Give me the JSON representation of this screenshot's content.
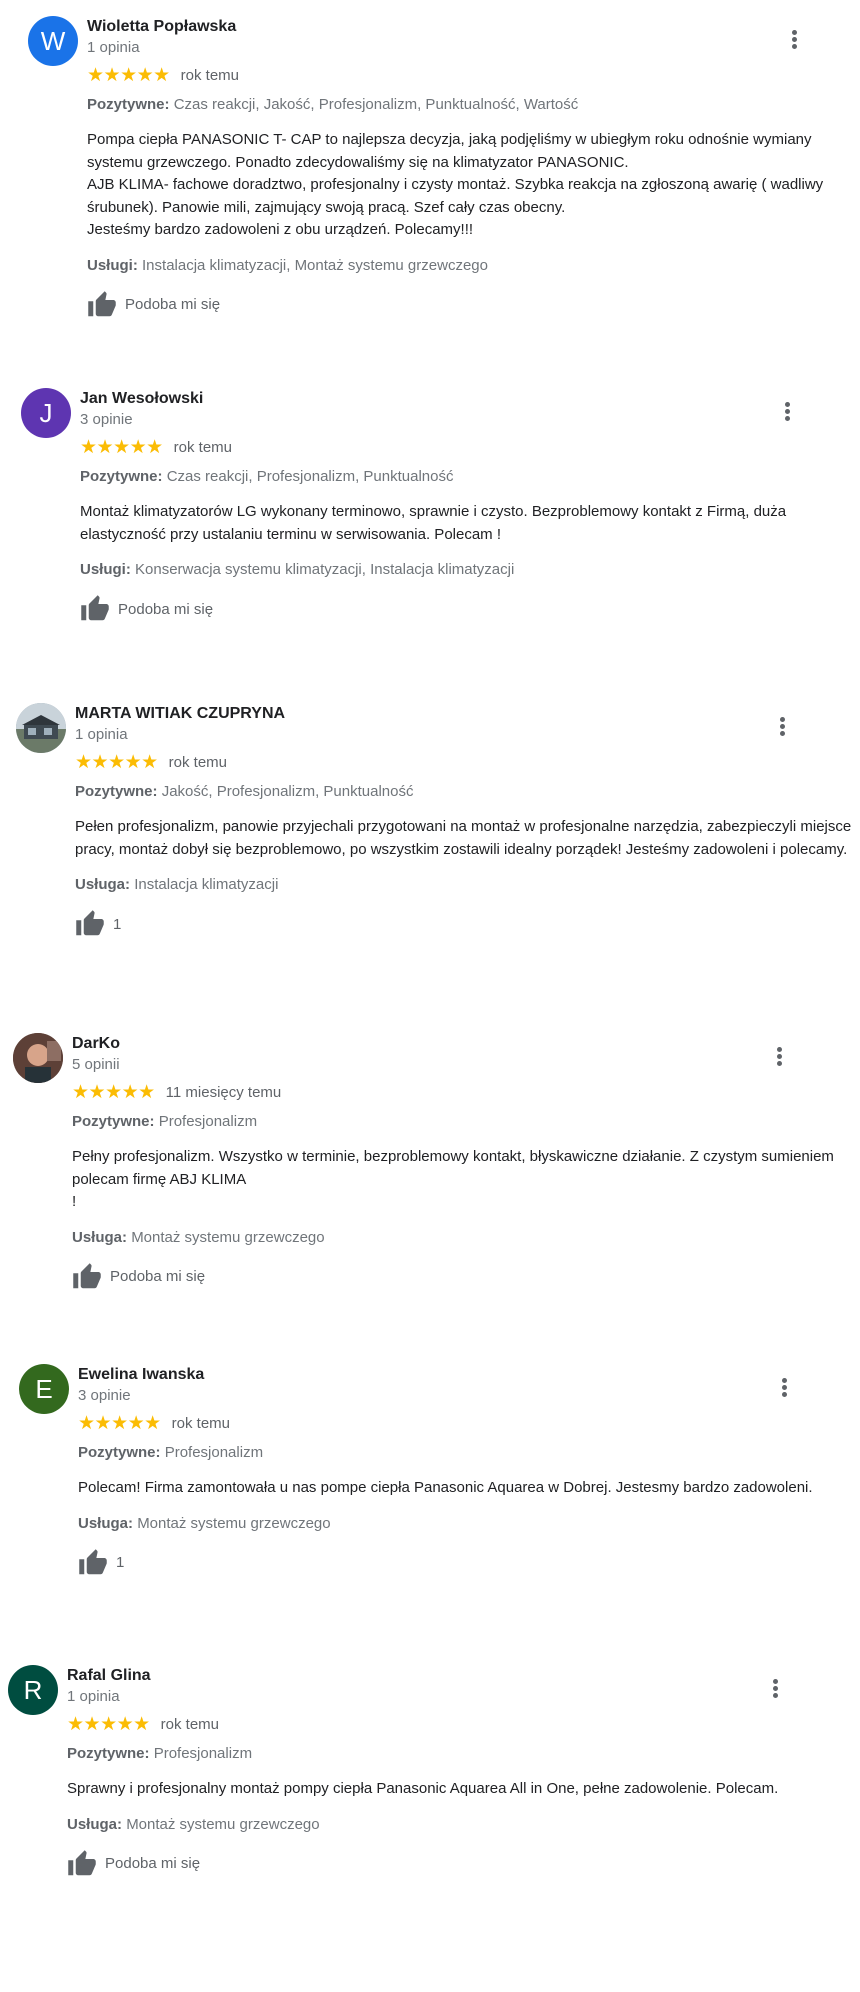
{
  "reviews": [
    {
      "name": "Wioletta Popławska",
      "count": "1 opinia",
      "avatar_letter": "W",
      "avatar_color": "#1a73e8",
      "stars": "★★★★★",
      "date": "rok temu",
      "positive_label": "Pozytywne:",
      "positive": "Czas reakcji, Jakość, Profesjonalizm, Punktualność, Wartość",
      "text": "Pompa ciepła PANASONIC T- CAP to najlepsza decyzja, jaką podjęliśmy w ubiegłym roku odnośnie wymiany systemu grzewczego. Ponadto zdecydowaliśmy się na klimatyzator PANASONIC.\nAJB KLIMA- fachowe doradztwo, profesjonalny i czysty montaż. Szybka reakcja na zgłoszoną awarię ( wadliwy śrubunek). Panowie mili, zajmujący swoją pracą. Szef cały czas obecny.\nJesteśmy bardzo zadowoleni z obu urządzeń. Polecamy!!!",
      "services_label": "Usługi:",
      "services": "Instalacja klimatyzacji, Montaż systemu grzewczego",
      "like": "Podoba mi się"
    },
    {
      "name": "Jan Wesołowski",
      "count": "3 opinie",
      "avatar_letter": "J",
      "avatar_color": "#5e35b1",
      "stars": "★★★★★",
      "date": "rok temu",
      "positive_label": "Pozytywne:",
      "positive": "Czas reakcji, Profesjonalizm, Punktualność",
      "text": "Montaż klimatyzatorów LG wykonany terminowo, sprawnie i czysto. Bezproblemowy kontakt z Firmą, duża elastyczność przy ustalaniu terminu w serwisowania. Polecam !",
      "services_label": "Usługi:",
      "services": "Konserwacja systemu klimatyzacji, Instalacja klimatyzacji",
      "like": "Podoba mi się"
    },
    {
      "name": "MARTA WITIAK CZUPRYNA",
      "count": "1 opinia",
      "avatar_letter": "",
      "avatar_color": "#8a9aa6",
      "stars": "★★★★★",
      "date": "rok temu",
      "positive_label": "Pozytywne:",
      "positive": "Jakość, Profesjonalizm, Punktualność",
      "text": "Pełen profesjonalizm, panowie przyjechali przygotowani na montaż w profesjonalne narzędzia, zabezpieczyli miejsce pracy, montaż dobył się bezproblemowo, po wszystkim zostawili idealny porządek! Jesteśmy zadowoleni i polecamy.",
      "services_label": "Usługa:",
      "services": "Instalacja klimatyzacji",
      "like": "1"
    },
    {
      "name": "DarKo",
      "count": "5 opinii",
      "avatar_letter": "",
      "avatar_color": "#6d4c41",
      "stars": "★★★★★",
      "date": "11 miesięcy temu",
      "positive_label": "Pozytywne:",
      "positive": "Profesjonalizm",
      "text": "Pełny profesjonalizm. Wszystko w terminie, bezproblemowy kontakt, błyskawiczne działanie. Z czystym sumieniem polecam firmę ABJ KLIMA\n!",
      "services_label": "Usługa:",
      "services": "Montaż systemu grzewczego",
      "like": "Podoba mi się"
    },
    {
      "name": "Ewelina Iwanska",
      "count": "3 opinie",
      "avatar_letter": "E",
      "avatar_color": "#33691e",
      "stars": "★★★★★",
      "date": "rok temu",
      "positive_label": "Pozytywne:",
      "positive": "Profesjonalizm",
      "text": "Polecam! Firma zamontowała u nas pompe ciepła Panasonic Aquarea w Dobrej. Jestesmy bardzo zadowoleni.",
      "services_label": "Usługa:",
      "services": "Montaż systemu grzewczego",
      "like": "1"
    },
    {
      "name": "Rafal Glina",
      "count": "1 opinia",
      "avatar_letter": "R",
      "avatar_color": "#004d40",
      "stars": "★★★★★",
      "date": "rok temu",
      "positive_label": "Pozytywne:",
      "positive": "Profesjonalizm",
      "text": "Sprawny i profesjonalny montaż pompy ciepła Panasonic Aquarea All in One, pełne zadowolenie. Polecam.",
      "services_label": "Usługa:",
      "services": "Montaż systemu grzewczego",
      "like": "Podoba mi się"
    }
  ]
}
